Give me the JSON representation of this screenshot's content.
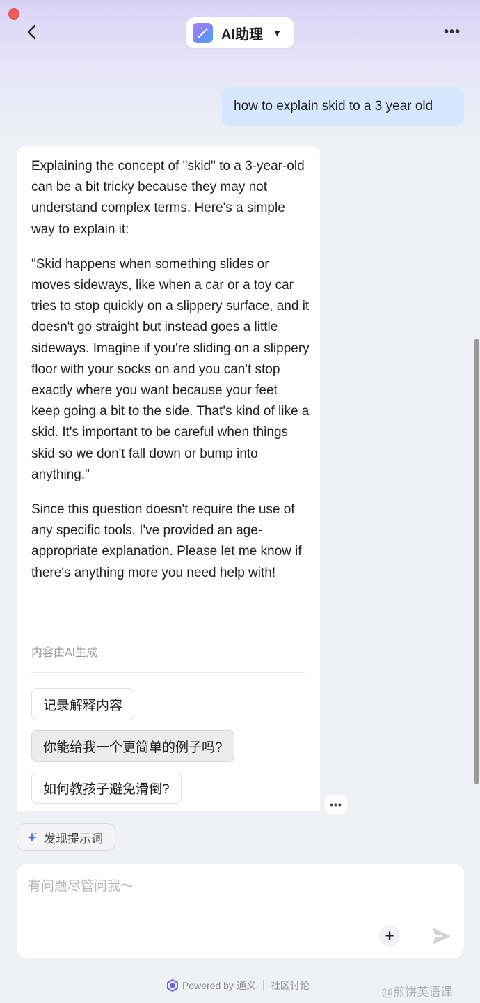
{
  "header": {
    "title": "AI助理",
    "back_icon": "chevron-left-icon",
    "more_icon": "more-horizontal-icon",
    "more_label": "•••"
  },
  "conversation": {
    "user_message": "how to explain skid to a 3 year old",
    "ai_paragraphs": [
      "Explaining the concept of \"skid\" to a 3-year-old can be a bit tricky because they may not understand complex terms. Here's a simple way to explain it:",
      "\"Skid happens when something slides or moves sideways, like when a car or a toy car tries to stop quickly on a slippery surface, and it doesn't go straight but instead goes a little sideways. Imagine if you're sliding on a slippery floor with your socks on and you can't stop exactly where you want because your feet keep going a bit to the side. That's kind of like a skid. It's important to be careful when things skid so we don't fall down or bump into anything.\"",
      "Since this question doesn't require the use of any specific tools, I've provided an age-appropriate explanation. Please let me know if there's anything more you need help with!"
    ],
    "ai_generated_note": "内容由AI生成",
    "suggestions": [
      "记录解释内容",
      "你能给我一个更简单的例子吗?",
      "如何教孩子避免滑倒?"
    ],
    "message_more_label": "•••"
  },
  "composer": {
    "discover_label": "发现提示词",
    "placeholder": "有问题尽管问我～",
    "value": "",
    "plus_label": "+"
  },
  "footer": {
    "powered_by": "Powered by 通义",
    "community": "社区讨论"
  },
  "watermark": "@煎饼英语课",
  "colors": {
    "user_bubble": "#d6e8fd",
    "accent": "#5b7cf7",
    "close_dot": "#ee5b5b"
  }
}
